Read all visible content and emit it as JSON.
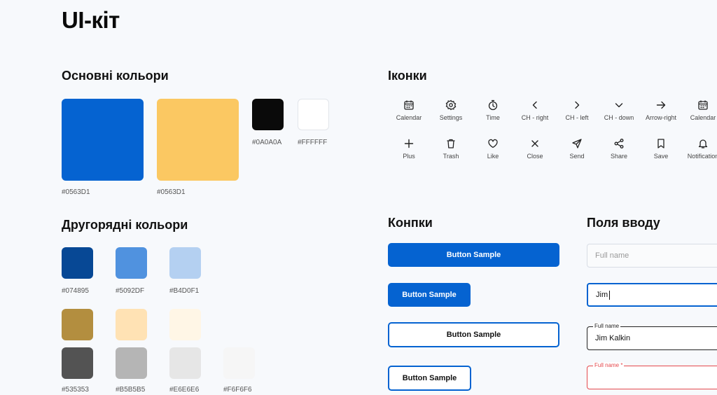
{
  "title": "UI-кіт",
  "primary_colors": {
    "title": "Основні кольори",
    "swatches": [
      {
        "color": "#0563D1",
        "label": "#0563D1"
      },
      {
        "color": "#FBC862",
        "label": "#0563D1"
      },
      {
        "color": "#0A0A0A",
        "label": "#0A0A0A"
      },
      {
        "color": "#FFFFFF",
        "label": "#FFFFFF"
      }
    ]
  },
  "secondary_colors": {
    "title": "Другорядні кольори",
    "row1": [
      {
        "color": "#074895",
        "label": "#074895"
      },
      {
        "color": "#5092DF",
        "label": "#5092DF"
      },
      {
        "color": "#B4D0F1",
        "label": "#B4D0F1"
      }
    ],
    "row2": [
      {
        "color": "#B38E3F"
      },
      {
        "color": "#FFE2B4"
      },
      {
        "color": "#FFF6E6"
      }
    ],
    "row3": [
      {
        "color": "#535353",
        "label": "#535353"
      },
      {
        "color": "#B5B5B5",
        "label": "#B5B5B5"
      },
      {
        "color": "#E6E6E6",
        "label": "#E6E6E6"
      },
      {
        "color": "#F6F6F6",
        "label": "#F6F6F6"
      }
    ]
  },
  "icons": {
    "title": "Іконки",
    "row1": [
      {
        "name": "calendar-icon",
        "label": "Calendar"
      },
      {
        "name": "settings-icon",
        "label": "Settings"
      },
      {
        "name": "time-icon",
        "label": "Time"
      },
      {
        "name": "chevron-right-icon",
        "label": "CH - right"
      },
      {
        "name": "chevron-left-icon",
        "label": "CH - left"
      },
      {
        "name": "chevron-down-icon",
        "label": "CH - down"
      },
      {
        "name": "arrow-right-icon",
        "label": "Arrow-right"
      },
      {
        "name": "calendar-icon",
        "label": "Calendar"
      }
    ],
    "row2": [
      {
        "name": "plus-icon",
        "label": "Plus"
      },
      {
        "name": "trash-icon",
        "label": "Trash"
      },
      {
        "name": "like-icon",
        "label": "Like"
      },
      {
        "name": "close-icon",
        "label": "Close"
      },
      {
        "name": "send-icon",
        "label": "Send"
      },
      {
        "name": "share-icon",
        "label": "Share"
      },
      {
        "name": "save-icon",
        "label": "Save"
      },
      {
        "name": "notification-icon",
        "label": "Notification"
      }
    ]
  },
  "buttons": {
    "title": "Конпки",
    "labels": [
      "Button Sample",
      "Button Sample",
      "Button Sample",
      "Button Sample"
    ],
    "primary_color": "#0563D1"
  },
  "inputs": {
    "title": "Поля вводу",
    "empty_placeholder": "Full name",
    "focused_value": "Jim",
    "filled_label": "Full name",
    "filled_value": "Jim Kalkin",
    "error_label": "Full name *",
    "error_color": "#E5484D"
  }
}
